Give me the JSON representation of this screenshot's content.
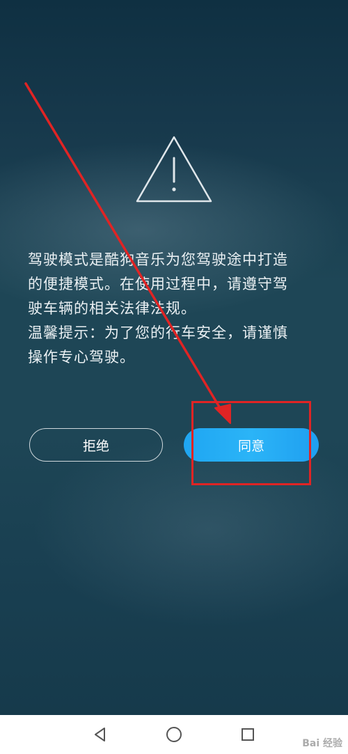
{
  "dialog": {
    "message_lines": [
      "驾驶模式是酷狗音乐为您驾驶途中打造",
      "的便捷模式。在使用过程中，请遵守驾",
      "驶车辆的相关法律法规。",
      "温馨提示：为了您的行车安全，请谨慎",
      "操作专心驾驶。"
    ],
    "refuse_label": "拒绝",
    "agree_label": "同意"
  },
  "annotation": {
    "arrow_color": "#e02424",
    "box_color": "#e02424"
  },
  "colors": {
    "agree_button": "#1fa6f2",
    "background": "#1e4656"
  },
  "navbar": {
    "back_icon": "back-triangle-icon",
    "home_icon": "home-circle-icon",
    "recents_icon": "recents-square-icon"
  },
  "watermark": {
    "text": "Bai 经验"
  }
}
